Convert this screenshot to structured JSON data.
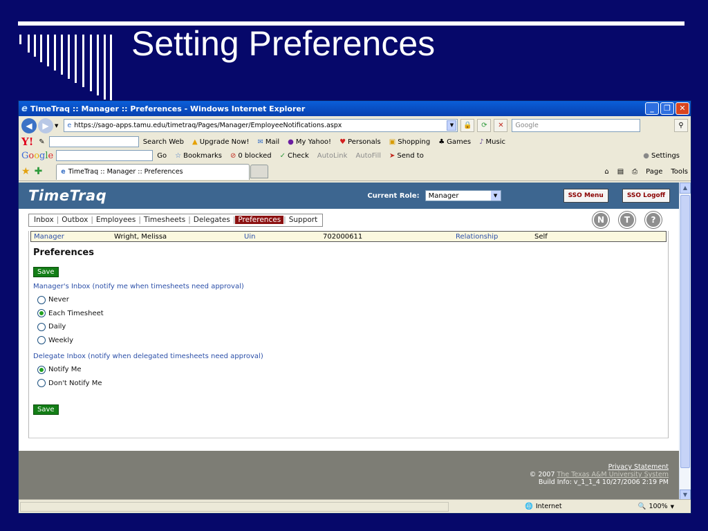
{
  "slide": {
    "title": "Setting Preferences"
  },
  "browser": {
    "window_title": "TimeTraq :: Manager :: Preferences - Windows Internet Explorer",
    "url": "https://sago-apps.tamu.edu/timetraq/Pages/Manager/EmployeeNotifications.aspx",
    "search_placeholder": "Google",
    "yahoo_toolbar": {
      "logo": "Y!",
      "search_web": "Search Web",
      "upgrade": "Upgrade Now!",
      "mail": "Mail",
      "my_yahoo": "My Yahoo!",
      "personals": "Personals",
      "shopping": "Shopping",
      "games": "Games",
      "music": "Music"
    },
    "google_toolbar": {
      "go": "Go",
      "bookmarks": "Bookmarks",
      "blocked": "0 blocked",
      "check": "Check",
      "autolink": "AutoLink",
      "autofill": "AutoFill",
      "send_to": "Send to",
      "settings": "Settings"
    },
    "tab_title": "TimeTraq :: Manager :: Preferences",
    "cmd_page": "Page",
    "cmd_tools": "Tools",
    "status_zone": "Internet",
    "zoom": "100%"
  },
  "app": {
    "logo": "TimeTraq",
    "current_role_label": "Current Role:",
    "current_role": "Manager",
    "sso_menu": "SSO Menu",
    "sso_logoff": "SSO Logoff",
    "nav": [
      "Inbox",
      "Outbox",
      "Employees",
      "Timesheets",
      "Delegates",
      "Preferences",
      "Support"
    ],
    "active_nav": "Preferences",
    "circle_buttons": [
      "N",
      "T",
      "?"
    ],
    "info": {
      "role": "Manager",
      "name": "Wright, Melissa",
      "uin_label": "Uin",
      "uin": "702000611",
      "relationship_label": "Relationship",
      "relationship": "Self"
    },
    "page_title": "Preferences",
    "save_label": "Save",
    "manager_inbox_label": "Manager's Inbox (notify me when timesheets need approval)",
    "manager_options": [
      {
        "label": "Never",
        "selected": false
      },
      {
        "label": "Each Timesheet",
        "selected": true
      },
      {
        "label": "Daily",
        "selected": false
      },
      {
        "label": "Weekly",
        "selected": false
      }
    ],
    "delegate_inbox_label": "Delegate Inbox (notify when delegated timesheets need approval)",
    "delegate_options": [
      {
        "label": "Notify Me",
        "selected": true
      },
      {
        "label": "Don't Notify Me",
        "selected": false
      }
    ],
    "footer": {
      "privacy": "Privacy Statement",
      "copyright": "© 2007",
      "org": "The Texas A&M University System",
      "build": "Build Info:  v_1_1_4 10/27/2006 2:19 PM"
    }
  },
  "colors": {
    "slide_bg": "#06086a",
    "app_header": "#3d6690",
    "active_tab": "#8b1010",
    "save_button": "#137e16",
    "footer_bg": "#7d7d75"
  }
}
